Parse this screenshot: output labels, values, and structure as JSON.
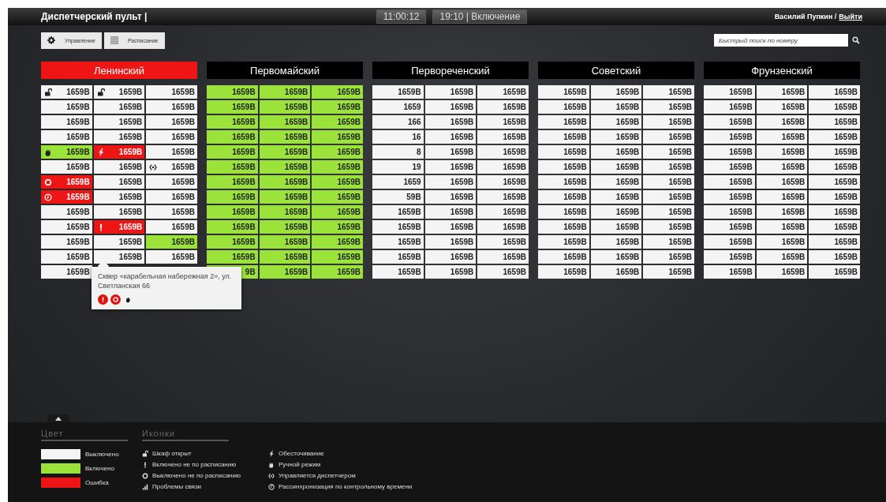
{
  "header": {
    "title": "Диспетчерский пульт |",
    "clock": "11:00:12",
    "next_event": "19:10 | Включение",
    "user": "Василий Пупкин /",
    "logout": "Выйти"
  },
  "toolbar": {
    "buttons": [
      {
        "kind": "gear",
        "label": "Управление"
      },
      {
        "kind": "grid",
        "label": "Расписание"
      }
    ],
    "search": {
      "placeholder": "Быстрый поиск по номеру"
    }
  },
  "districts": [
    {
      "name": "Ленинский",
      "selected": true,
      "rows": [
        [
          {
            "number": "1659В",
            "color": "#f4f4f4",
            "kind": "lock"
          },
          {
            "number": "1659В",
            "color": "#f4f4f4",
            "kind": "lock"
          },
          {
            "number": "1659В",
            "color": "#f4f4f4"
          }
        ],
        [
          {
            "number": "1659В",
            "color": "#f4f4f4"
          },
          {
            "number": "1659В",
            "color": "#f4f4f4"
          },
          {
            "number": "1659В",
            "color": "#f4f4f4"
          }
        ],
        [
          {
            "number": "1659В",
            "color": "#f4f4f4"
          },
          {
            "number": "1659В",
            "color": "#f4f4f4"
          },
          {
            "number": "1659В",
            "color": "#f4f4f4"
          }
        ],
        [
          {
            "number": "1659В",
            "color": "#f4f4f4"
          },
          {
            "number": "1659В",
            "color": "#f4f4f4"
          },
          {
            "number": "1659В",
            "color": "#f4f4f4"
          }
        ],
        [
          {
            "number": "1659В",
            "color": "#9be33b",
            "kind": "manual"
          },
          {
            "number": "1659В",
            "color": "#f01515",
            "kind": "power_cut"
          },
          {
            "number": "1659В",
            "color": "#f4f4f4"
          }
        ],
        [
          {
            "number": "1659В",
            "color": "#f4f4f4"
          },
          {
            "number": "1659В",
            "color": "#f4f4f4"
          },
          {
            "number": "1659В",
            "color": "#f4f4f4",
            "kind": "dispatcher"
          }
        ],
        [
          {
            "number": "1659В",
            "color": "#f01515",
            "kind": "off_schedule"
          },
          {
            "number": "1659В",
            "color": "#f4f4f4"
          },
          {
            "number": "1659В",
            "color": "#f4f4f4"
          }
        ],
        [
          {
            "number": "1659В",
            "color": "#f01515",
            "kind": "resync"
          },
          {
            "number": "1659В",
            "color": "#f4f4f4"
          },
          {
            "number": "1659В",
            "color": "#f4f4f4"
          }
        ],
        [
          {
            "number": "1659В",
            "color": "#f4f4f4"
          },
          {
            "number": "1659В",
            "color": "#f4f4f4"
          },
          {
            "number": "1659В",
            "color": "#f4f4f4"
          }
        ],
        [
          {
            "number": "1659В",
            "color": "#f4f4f4"
          },
          {
            "number": "1659В",
            "color": "#f01515",
            "kind": "on_schedule"
          },
          {
            "number": "1659В",
            "color": "#f4f4f4"
          }
        ],
        [
          {
            "number": "1659В",
            "color": "#f4f4f4"
          },
          {
            "number": "1659В",
            "color": "#f4f4f4"
          },
          {
            "number": "1659В",
            "color": "#9be33b"
          }
        ],
        [
          {
            "number": "1659В",
            "color": "#f4f4f4"
          },
          {
            "number": "1659В",
            "color": "#f4f4f4"
          },
          {
            "number": "1659В",
            "color": "#f4f4f4"
          }
        ],
        [
          {
            "number": "1659В",
            "color": "#f4f4f4"
          }
        ]
      ]
    },
    {
      "name": "Первомайский",
      "selected": false,
      "rows": [
        [
          {
            "number": "1659В",
            "color": "#9be33b"
          },
          {
            "number": "1659В",
            "color": "#9be33b"
          },
          {
            "number": "1659В",
            "color": "#9be33b"
          }
        ],
        [
          {
            "number": "1659В",
            "color": "#9be33b"
          },
          {
            "number": "1659В",
            "color": "#9be33b"
          },
          {
            "number": "1659В",
            "color": "#9be33b"
          }
        ],
        [
          {
            "number": "1659В",
            "color": "#9be33b"
          },
          {
            "number": "1659В",
            "color": "#9be33b"
          },
          {
            "number": "1659В",
            "color": "#9be33b"
          }
        ],
        [
          {
            "number": "1659В",
            "color": "#9be33b"
          },
          {
            "number": "1659В",
            "color": "#9be33b"
          },
          {
            "number": "1659В",
            "color": "#9be33b"
          }
        ],
        [
          {
            "number": "1659В",
            "color": "#9be33b"
          },
          {
            "number": "1659В",
            "color": "#9be33b"
          },
          {
            "number": "1659В",
            "color": "#9be33b"
          }
        ],
        [
          {
            "number": "1659В",
            "color": "#9be33b"
          },
          {
            "number": "1659В",
            "color": "#9be33b"
          },
          {
            "number": "1659В",
            "color": "#9be33b"
          }
        ],
        [
          {
            "number": "1659В",
            "color": "#9be33b"
          },
          {
            "number": "1659В",
            "color": "#9be33b"
          },
          {
            "number": "1659В",
            "color": "#9be33b"
          }
        ],
        [
          {
            "number": "1659В",
            "color": "#9be33b"
          },
          {
            "number": "1659В",
            "color": "#9be33b"
          },
          {
            "number": "1659В",
            "color": "#9be33b"
          }
        ],
        [
          {
            "number": "1659В",
            "color": "#9be33b"
          },
          {
            "number": "1659В",
            "color": "#9be33b"
          },
          {
            "number": "1659В",
            "color": "#9be33b"
          }
        ],
        [
          {
            "number": "1659В",
            "color": "#9be33b"
          },
          {
            "number": "1659В",
            "color": "#9be33b"
          },
          {
            "number": "1659В",
            "color": "#9be33b"
          }
        ],
        [
          {
            "number": "1659В",
            "color": "#9be33b"
          },
          {
            "number": "1659В",
            "color": "#9be33b"
          },
          {
            "number": "1659В",
            "color": "#9be33b"
          }
        ],
        [
          {
            "number": "1659В",
            "color": "#9be33b"
          },
          {
            "number": "1659В",
            "color": "#9be33b"
          },
          {
            "number": "1659В",
            "color": "#9be33b"
          }
        ],
        [
          {
            "number": "9В",
            "color": "#9be33b"
          },
          {
            "number": "1659В",
            "color": "#9be33b"
          },
          {
            "number": "1659В",
            "color": "#9be33b"
          }
        ]
      ]
    },
    {
      "name": "Первореченский",
      "selected": false,
      "rows": [
        [
          {
            "number": "1659В",
            "color": "#f4f4f4"
          },
          {
            "number": "1659В",
            "color": "#f4f4f4"
          },
          {
            "number": "1659В",
            "color": "#f4f4f4"
          }
        ],
        [
          {
            "number": "1659",
            "color": "#f4f4f4"
          },
          {
            "number": "1659В",
            "color": "#f4f4f4"
          },
          {
            "number": "1659В",
            "color": "#f4f4f4"
          }
        ],
        [
          {
            "number": "166",
            "color": "#f4f4f4"
          },
          {
            "number": "1659В",
            "color": "#f4f4f4"
          },
          {
            "number": "1659В",
            "color": "#f4f4f4"
          }
        ],
        [
          {
            "number": "16",
            "color": "#f4f4f4"
          },
          {
            "number": "1659В",
            "color": "#f4f4f4"
          },
          {
            "number": "1659В",
            "color": "#f4f4f4"
          }
        ],
        [
          {
            "number": "8",
            "color": "#f4f4f4"
          },
          {
            "number": "1659В",
            "color": "#f4f4f4"
          },
          {
            "number": "1659В",
            "color": "#f4f4f4"
          }
        ],
        [
          {
            "number": "19",
            "color": "#f4f4f4"
          },
          {
            "number": "1659В",
            "color": "#f4f4f4"
          },
          {
            "number": "1659В",
            "color": "#f4f4f4"
          }
        ],
        [
          {
            "number": "1659",
            "color": "#f4f4f4"
          },
          {
            "number": "1659В",
            "color": "#f4f4f4"
          },
          {
            "number": "1659В",
            "color": "#f4f4f4"
          }
        ],
        [
          {
            "number": "59В",
            "color": "#f4f4f4"
          },
          {
            "number": "1659В",
            "color": "#f4f4f4"
          },
          {
            "number": "1659В",
            "color": "#f4f4f4"
          }
        ],
        [
          {
            "number": "1659В",
            "color": "#f4f4f4"
          },
          {
            "number": "1659В",
            "color": "#f4f4f4"
          },
          {
            "number": "1659В",
            "color": "#f4f4f4"
          }
        ],
        [
          {
            "number": "1659В",
            "color": "#f4f4f4"
          },
          {
            "number": "1659В",
            "color": "#f4f4f4"
          },
          {
            "number": "1659В",
            "color": "#f4f4f4"
          }
        ],
        [
          {
            "number": "1659В",
            "color": "#f4f4f4"
          },
          {
            "number": "1659В",
            "color": "#f4f4f4"
          },
          {
            "number": "1659В",
            "color": "#f4f4f4"
          }
        ],
        [
          {
            "number": "1659В",
            "color": "#f4f4f4"
          },
          {
            "number": "1659В",
            "color": "#f4f4f4"
          },
          {
            "number": "1659В",
            "color": "#f4f4f4"
          }
        ],
        [
          {
            "number": "1659В",
            "color": "#f4f4f4"
          },
          {
            "number": "1659В",
            "color": "#f4f4f4"
          },
          {
            "number": "1659В",
            "color": "#f4f4f4"
          }
        ]
      ]
    },
    {
      "name": "Советский",
      "selected": false,
      "rows": [
        [
          {
            "number": "1659В",
            "color": "#f4f4f4"
          },
          {
            "number": "1659В",
            "color": "#f4f4f4"
          },
          {
            "number": "1659В",
            "color": "#f4f4f4"
          }
        ],
        [
          {
            "number": "1659В",
            "color": "#f4f4f4"
          },
          {
            "number": "1659В",
            "color": "#f4f4f4"
          },
          {
            "number": "1659В",
            "color": "#f4f4f4"
          }
        ],
        [
          {
            "number": "1659В",
            "color": "#f4f4f4"
          },
          {
            "number": "1659В",
            "color": "#f4f4f4"
          },
          {
            "number": "1659В",
            "color": "#f4f4f4"
          }
        ],
        [
          {
            "number": "1659В",
            "color": "#f4f4f4"
          },
          {
            "number": "1659В",
            "color": "#f4f4f4"
          },
          {
            "number": "1659В",
            "color": "#f4f4f4"
          }
        ],
        [
          {
            "number": "1659В",
            "color": "#f4f4f4"
          },
          {
            "number": "1659В",
            "color": "#f4f4f4"
          },
          {
            "number": "1659В",
            "color": "#f4f4f4"
          }
        ],
        [
          {
            "number": "1659В",
            "color": "#f4f4f4"
          },
          {
            "number": "1659В",
            "color": "#f4f4f4"
          },
          {
            "number": "1659В",
            "color": "#f4f4f4"
          }
        ],
        [
          {
            "number": "1659В",
            "color": "#f4f4f4"
          },
          {
            "number": "1659В",
            "color": "#f4f4f4"
          },
          {
            "number": "1659В",
            "color": "#f4f4f4"
          }
        ],
        [
          {
            "number": "1659В",
            "color": "#f4f4f4"
          },
          {
            "number": "1659В",
            "color": "#f4f4f4"
          },
          {
            "number": "1659В",
            "color": "#f4f4f4"
          }
        ],
        [
          {
            "number": "1659В",
            "color": "#f4f4f4"
          },
          {
            "number": "1659В",
            "color": "#f4f4f4"
          },
          {
            "number": "1659В",
            "color": "#f4f4f4"
          }
        ],
        [
          {
            "number": "1659В",
            "color": "#f4f4f4"
          },
          {
            "number": "1659В",
            "color": "#f4f4f4"
          },
          {
            "number": "1659В",
            "color": "#f4f4f4"
          }
        ],
        [
          {
            "number": "1659В",
            "color": "#f4f4f4"
          },
          {
            "number": "1659В",
            "color": "#f4f4f4"
          },
          {
            "number": "1659В",
            "color": "#f4f4f4"
          }
        ],
        [
          {
            "number": "1659В",
            "color": "#f4f4f4"
          },
          {
            "number": "1659В",
            "color": "#f4f4f4"
          },
          {
            "number": "1659В",
            "color": "#f4f4f4"
          }
        ],
        [
          {
            "number": "1659В",
            "color": "#f4f4f4"
          },
          {
            "number": "1659В",
            "color": "#f4f4f4"
          },
          {
            "number": "1659В",
            "color": "#f4f4f4"
          }
        ]
      ]
    },
    {
      "name": "Фрунзенский",
      "selected": false,
      "rows": [
        [
          {
            "number": "1659В",
            "color": "#f4f4f4"
          },
          {
            "number": "1659В",
            "color": "#f4f4f4"
          },
          {
            "number": "1659В",
            "color": "#f4f4f4"
          }
        ],
        [
          {
            "number": "1659В",
            "color": "#f4f4f4"
          },
          {
            "number": "1659В",
            "color": "#f4f4f4"
          },
          {
            "number": "1659В",
            "color": "#f4f4f4"
          }
        ],
        [
          {
            "number": "1659В",
            "color": "#f4f4f4"
          },
          {
            "number": "1659В",
            "color": "#f4f4f4"
          },
          {
            "number": "1659В",
            "color": "#f4f4f4"
          }
        ],
        [
          {
            "number": "1659В",
            "color": "#f4f4f4"
          },
          {
            "number": "1659В",
            "color": "#f4f4f4"
          },
          {
            "number": "1659В",
            "color": "#f4f4f4"
          }
        ],
        [
          {
            "number": "1659В",
            "color": "#f4f4f4"
          },
          {
            "number": "1659В",
            "color": "#f4f4f4"
          },
          {
            "number": "1659В",
            "color": "#f4f4f4"
          }
        ],
        [
          {
            "number": "1659В",
            "color": "#f4f4f4"
          },
          {
            "number": "1659В",
            "color": "#f4f4f4"
          },
          {
            "number": "1659В",
            "color": "#f4f4f4"
          }
        ],
        [
          {
            "number": "1659В",
            "color": "#f4f4f4"
          },
          {
            "number": "1659В",
            "color": "#f4f4f4"
          },
          {
            "number": "1659В",
            "color": "#f4f4f4"
          }
        ],
        [
          {
            "number": "1659В",
            "color": "#f4f4f4"
          },
          {
            "number": "1659В",
            "color": "#f4f4f4"
          },
          {
            "number": "1659В",
            "color": "#f4f4f4"
          }
        ],
        [
          {
            "number": "1659В",
            "color": "#f4f4f4"
          },
          {
            "number": "1659В",
            "color": "#f4f4f4"
          },
          {
            "number": "1659В",
            "color": "#f4f4f4"
          }
        ],
        [
          {
            "number": "1659В",
            "color": "#f4f4f4"
          },
          {
            "number": "1659В",
            "color": "#f4f4f4"
          },
          {
            "number": "1659В",
            "color": "#f4f4f4"
          }
        ],
        [
          {
            "number": "1659В",
            "color": "#f4f4f4"
          },
          {
            "number": "1659В",
            "color": "#f4f4f4"
          },
          {
            "number": "1659В",
            "color": "#f4f4f4"
          }
        ],
        [
          {
            "number": "1659В",
            "color": "#f4f4f4"
          },
          {
            "number": "1659В",
            "color": "#f4f4f4"
          },
          {
            "number": "1659В",
            "color": "#f4f4f4"
          }
        ],
        [
          {
            "number": "1659В",
            "color": "#f4f4f4"
          },
          {
            "number": "1659В",
            "color": "#f4f4f4"
          },
          {
            "number": "1659В",
            "color": "#f4f4f4"
          }
        ]
      ]
    }
  ],
  "tooltip": {
    "address": "Сквер «карабельная набережная 2», ул. Светланская 66",
    "icons": [
      {
        "kind": "on_schedule",
        "alert": true
      },
      {
        "kind": "off_schedule",
        "alert": true
      },
      {
        "kind": "manual",
        "alert": false
      }
    ]
  },
  "legend": {
    "colors_title": "Цвет",
    "colors": [
      {
        "color": "#f4f4f4",
        "label": "Выключено"
      },
      {
        "color": "#9be33b",
        "label": "Включено"
      },
      {
        "color": "#f01515",
        "label": "Ошибка"
      }
    ],
    "icons_title": "Иконки",
    "icons": [
      {
        "kind": "lock",
        "label": "Шкаф открыт"
      },
      {
        "kind": "on_schedule",
        "label": "Включено не по расписанию"
      },
      {
        "kind": "off_schedule",
        "label": "Выключено не по расписанию"
      },
      {
        "kind": "signal",
        "label": "Проблемы связи"
      },
      {
        "kind": "power_cut",
        "label": "Обесточивание"
      },
      {
        "kind": "manual",
        "label": "Ручной режим"
      },
      {
        "kind": "dispatcher",
        "label": "Управляется диспетчером"
      },
      {
        "kind": "resync",
        "label": "Рассинхронизация по контрольному времени"
      }
    ]
  }
}
